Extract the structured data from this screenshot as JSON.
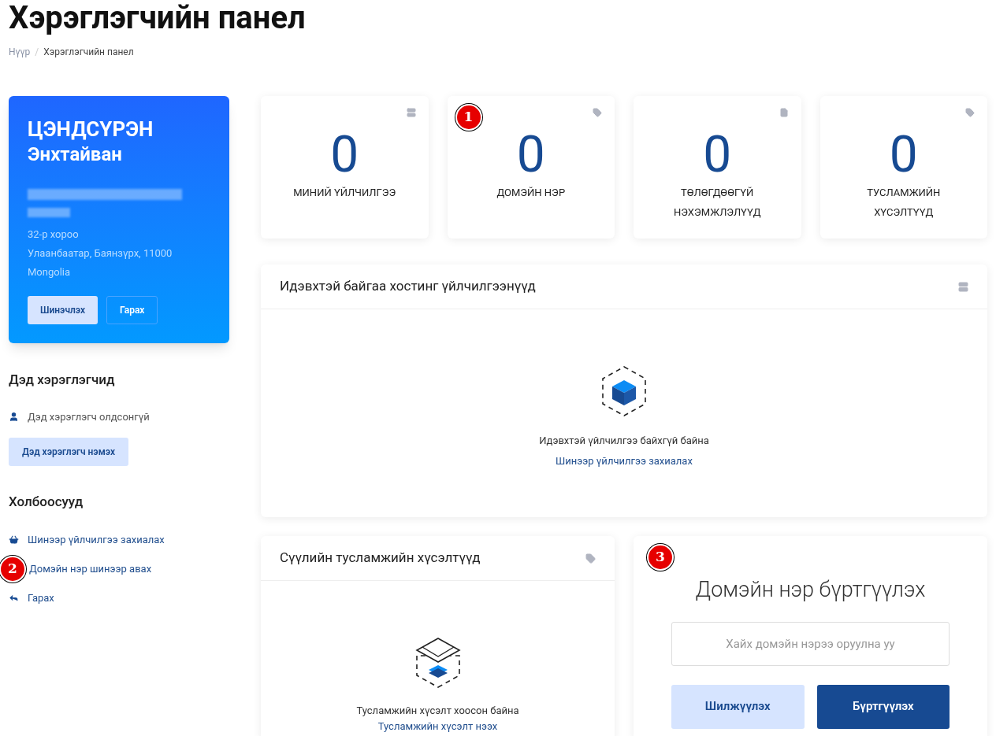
{
  "page_title": "Хэрэглэгчийн панел",
  "breadcrumb_separator": "/",
  "breadcrumb": [
    {
      "label": "Нүүр",
      "current": false
    },
    {
      "label": "Хэрэглэгчийн панел",
      "current": true
    }
  ],
  "profile": {
    "surname": "ЦЭНДСҮРЭН",
    "given_name": "Энхтайван",
    "address_lines": [
      "32-р хороо",
      "Улаанбаатар, Баянзүрх, 11000",
      "Mongolia"
    ],
    "buttons": [
      {
        "label": "Шинэчлэх",
        "kind": "light"
      },
      {
        "label": "Гарах",
        "kind": "outline"
      }
    ]
  },
  "sub_users": {
    "heading": "Дэд хэрэглэгчид",
    "empty_text": "Дэд хэрэглэгч олдсонгүй",
    "add_button": "Дэд хэрэглэгч нэмэх"
  },
  "links": {
    "heading": "Холбоосууд",
    "items": [
      {
        "label": "Шинээр үйлчилгээ захиалах"
      },
      {
        "label": "Домэйн нэр шинээр авах",
        "marker": "2"
      },
      {
        "label": "Гарах"
      }
    ]
  },
  "stats": [
    {
      "value": "0",
      "label": "МИНИЙ ҮЙЛЧИЛГЭЭ"
    },
    {
      "value": "0",
      "label": "ДОМЭЙН НЭР",
      "marker": "1"
    },
    {
      "value": "0",
      "label": "ТӨЛӨГДӨӨГҮЙ НЭХЭМЖЛЭЛҮҮД"
    },
    {
      "value": "0",
      "label": "ТУСЛАМЖИЙН ХҮСЭЛТҮҮД"
    }
  ],
  "hosting_panel": {
    "title": "Идэвхтэй байгаа хостинг үйлчилгээнүүд",
    "empty_text": "Идэвхтэй үйлчилгээ байхгүй байна",
    "link": "Шинээр үйлчилгээ захиалах"
  },
  "tickets_panel": {
    "title": "Сүүлийн тусламжийн хүсэлтүүд",
    "empty_text": "Тусламжийн хүсэлт хоосон байна",
    "link": "Тусламжийн хүсэлт нээх"
  },
  "domain_panel": {
    "title": "Домэйн нэр бүртгүүлэх",
    "marker": "3",
    "search": {
      "placeholder": "Хайх домэйн нэрээ оруулна уу"
    },
    "buttons": [
      {
        "label": "Шилжүүлэх",
        "kind": "light"
      },
      {
        "label": "Бүртгүүлэх",
        "kind": "primary"
      }
    ]
  }
}
